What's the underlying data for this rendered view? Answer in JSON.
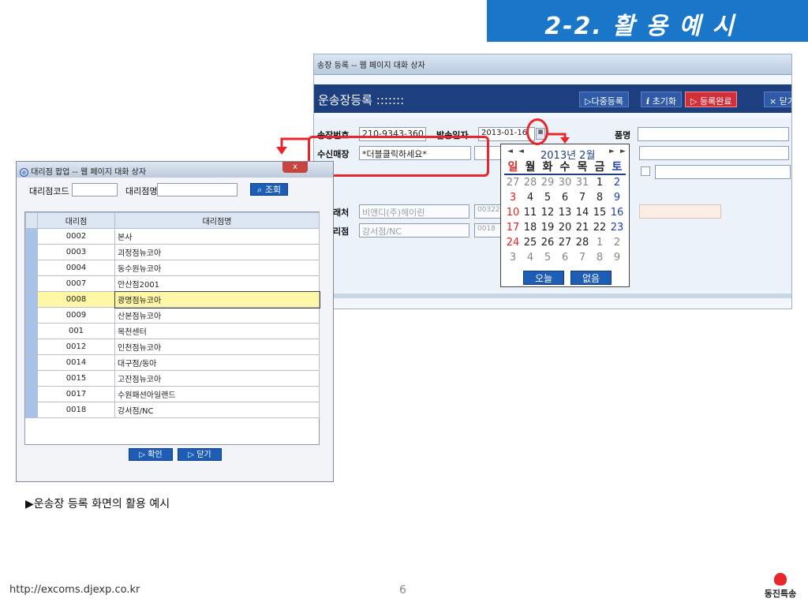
{
  "slide": {
    "title": "2-2. 활 용 예 시",
    "caption": "▶운송장 등록 화면의 활용 예시",
    "footer_url": "http://excoms.djexp.co.kr",
    "page_number": "6",
    "logo_text": "동진특송"
  },
  "main_window": {
    "title": "송장 등록 -- 웹 페이지 대화 상자",
    "header_title": "운송장등록 :::::::",
    "buttons": {
      "multi_register": "▷다중등록",
      "reset": "초기화",
      "reset_icon": "i",
      "complete": "▷ 등록완료",
      "close": "× 닫기"
    },
    "form": {
      "invoice_no_label": "송장번호",
      "invoice_no_value": "210-9343-360",
      "ship_date_label": "발송일자",
      "ship_date_value": "2013-01-16",
      "item_label": "품명",
      "receiver_shop_label": "수신매장",
      "receiver_shop_value": "*더블클릭하세요*",
      "client_label": "래처",
      "client_value": "비앤디(주)헤이린",
      "client_code": "00322",
      "agency_label": "리점",
      "agency_value": "강서점/NC",
      "agency_code": "0018"
    }
  },
  "calendar": {
    "month_label": "2013년 2월",
    "prev_year": "◄",
    "prev_month": "◄",
    "next_month": "►",
    "next_year": "►",
    "weekdays": [
      "일",
      "월",
      "화",
      "수",
      "목",
      "금",
      "토"
    ],
    "weeks": [
      [
        "27",
        "28",
        "29",
        "30",
        "31",
        "1",
        "2"
      ],
      [
        "3",
        "4",
        "5",
        "6",
        "7",
        "8",
        "9"
      ],
      [
        "10",
        "11",
        "12",
        "13",
        "14",
        "15",
        "16"
      ],
      [
        "17",
        "18",
        "19",
        "20",
        "21",
        "22",
        "23"
      ],
      [
        "24",
        "25",
        "26",
        "27",
        "28",
        "1",
        "2"
      ],
      [
        "3",
        "4",
        "5",
        "6",
        "7",
        "8",
        "9"
      ]
    ],
    "today_button": "오늘",
    "none_button": "없음"
  },
  "popup": {
    "title": "대리점 팝업 -- 웹 페이지 대화 상자",
    "close": "x",
    "code_label": "대리점코드",
    "name_label": "대리점명",
    "search_button": "조회",
    "columns": [
      "대리점",
      "대리점명"
    ],
    "rows": [
      {
        "code": "0002",
        "name": "본사"
      },
      {
        "code": "0003",
        "name": "괴정점뉴코아"
      },
      {
        "code": "0004",
        "name": "동수원뉴코아"
      },
      {
        "code": "0007",
        "name": "안산점2001"
      },
      {
        "code": "0008",
        "name": "광명점뉴코아",
        "highlighted": true
      },
      {
        "code": "0009",
        "name": "산본점뉴코아"
      },
      {
        "code": "001",
        "name": "목천센터"
      },
      {
        "code": "0012",
        "name": "인천점뉴코아"
      },
      {
        "code": "0014",
        "name": "대구점/동아"
      },
      {
        "code": "0015",
        "name": "고잔점뉴코아"
      },
      {
        "code": "0017",
        "name": "수원패션아일랜드"
      },
      {
        "code": "0018",
        "name": "강서점/NC"
      }
    ],
    "confirm_button": "▷ 확인",
    "close_button": "▷ 닫기"
  },
  "colors": {
    "accent": "#1976c8",
    "header_navy": "#1e3f7f",
    "annotation_red": "#e8262b"
  }
}
